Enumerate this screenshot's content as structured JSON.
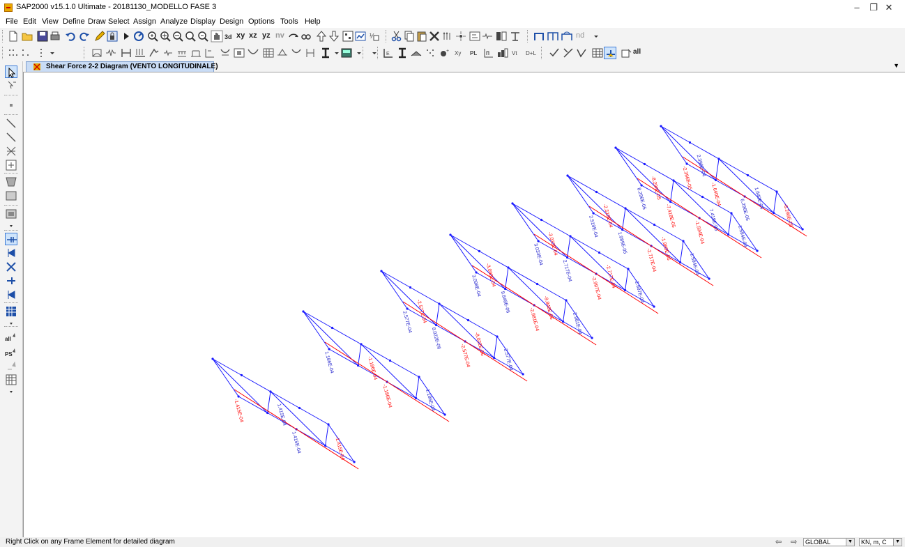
{
  "window": {
    "title": "SAP2000 v15.1.0 Ultimate  - 20181130_MODELLO FASE 3",
    "minimize": "–",
    "maximize": "❐",
    "close": "✕"
  },
  "menu": [
    "File",
    "Edit",
    "View",
    "Define",
    "Draw",
    "Select",
    "Assign",
    "Analyze",
    "Display",
    "Design",
    "Options",
    "Tools",
    "Help"
  ],
  "toolbar": {
    "view_labels": [
      "xy",
      "xz",
      "yz",
      "nv"
    ],
    "nd_label": "nd",
    "all_label": "all"
  },
  "lefttoolbar": {
    "labels": [
      "all",
      "PS"
    ]
  },
  "tab": {
    "label": "Shear Force 2-2 Diagram  (VENTO LONGITUDINALE)",
    "arrow": "▼"
  },
  "diagram": {
    "line_color": "#1a1aff",
    "positive_color": "#2222cc",
    "negative_color": "#ff0000",
    "trusses": [
      {
        "labels": [
          {
            "text": "-1.415E-04",
            "sign": "neg"
          },
          {
            "text": "1.415E-04",
            "sign": "pos"
          },
          {
            "text": "1.415E-04",
            "sign": "pos"
          },
          {
            "text": "-1.415E-04",
            "sign": "neg"
          }
        ]
      },
      {
        "labels": [
          {
            "text": "1.186E-04",
            "sign": "pos"
          },
          {
            "text": "-1.186E-04",
            "sign": "neg"
          },
          {
            "text": "-1.186E-04",
            "sign": "neg"
          },
          {
            "text": "1.186E-04",
            "sign": "pos"
          }
        ]
      },
      {
        "labels": [
          {
            "text": "2.577E-04",
            "sign": "pos"
          },
          {
            "text": "-2.577E-04",
            "sign": "neg"
          },
          {
            "text": "8.022E-06",
            "sign": "pos"
          },
          {
            "text": "-8.022E-06",
            "sign": "neg"
          },
          {
            "text": "-2.577E-04",
            "sign": "neg"
          },
          {
            "text": "2.577E-04",
            "sign": "pos"
          }
        ]
      },
      {
        "labels": [
          {
            "text": "3.098E-04",
            "sign": "pos"
          },
          {
            "text": "-3.098E-04",
            "sign": "neg"
          },
          {
            "text": "9.848E-06",
            "sign": "pos"
          },
          {
            "text": "-9.848E-06",
            "sign": "neg"
          },
          {
            "text": "-2.981E-04",
            "sign": "neg"
          },
          {
            "text": "2.981E-04",
            "sign": "pos"
          }
        ]
      },
      {
        "labels": [
          {
            "text": "3.033E-04",
            "sign": "pos"
          },
          {
            "text": "-3.033E-04",
            "sign": "neg"
          },
          {
            "text": "2.717E-04",
            "sign": "pos"
          },
          {
            "text": "-2.717E-04",
            "sign": "neg"
          },
          {
            "text": "-2.997E-04",
            "sign": "neg"
          },
          {
            "text": "2.997E-04",
            "sign": "pos"
          }
        ]
      },
      {
        "labels": [
          {
            "text": "2.519E-04",
            "sign": "pos"
          },
          {
            "text": "-2.519E-04",
            "sign": "neg"
          },
          {
            "text": "1.989E-05",
            "sign": "pos"
          },
          {
            "text": "-1.989E-05",
            "sign": "neg"
          },
          {
            "text": "-2.717E-04",
            "sign": "neg"
          },
          {
            "text": "1.594E-04",
            "sign": "pos"
          }
        ]
      },
      {
        "labels": [
          {
            "text": "8.296E-05",
            "sign": "pos"
          },
          {
            "text": "-8.296E-05",
            "sign": "neg"
          },
          {
            "text": "-7.418E-05",
            "sign": "neg"
          },
          {
            "text": "7.418E-05",
            "sign": "pos"
          },
          {
            "text": "-1.594E-04",
            "sign": "neg"
          },
          {
            "text": "1.594E-04",
            "sign": "pos"
          }
        ]
      },
      {
        "labels": [
          {
            "text": "-2.396E-05",
            "sign": "neg"
          },
          {
            "text": "2.396E-04",
            "sign": "pos"
          },
          {
            "text": "-1.640E-04",
            "sign": "neg"
          },
          {
            "text": "1.640E-04",
            "sign": "pos"
          },
          {
            "text": "6.296E-05",
            "sign": "pos"
          },
          {
            "text": "-6.296E-05",
            "sign": "neg"
          }
        ]
      }
    ]
  },
  "status": {
    "message": "Right Click on any Frame Element for detailed diagram",
    "coord_system": "GLOBAL",
    "units": "KN, m, C",
    "dropdown": "▼",
    "back": "⇦",
    "forward": "⇨"
  }
}
